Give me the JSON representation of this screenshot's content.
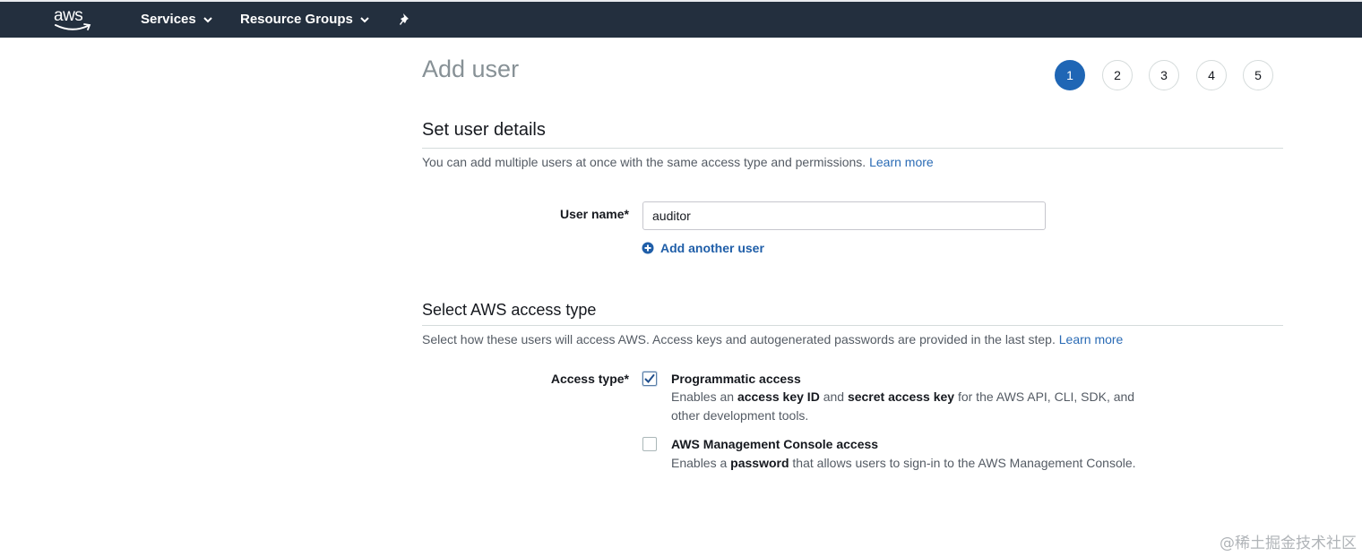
{
  "topbar": {
    "logo": "aws",
    "services_label": "Services",
    "resource_groups_label": "Resource Groups",
    "colors": {
      "background": "#232f3e",
      "text": "#ffffff"
    }
  },
  "page": {
    "title": "Add user",
    "steps": [
      "1",
      "2",
      "3",
      "4",
      "5"
    ],
    "active_step": "1",
    "accent_color": "#1f66b5"
  },
  "user_details": {
    "title": "Set user details",
    "description": "You can add multiple users at once with the same access type and permissions.",
    "learn_more": "Learn more",
    "username_label": "User name*",
    "username_value": "auditor",
    "add_another_user": "Add another user"
  },
  "access_type": {
    "title": "Select AWS access type",
    "description": "Select how these users will access AWS. Access keys and autogenerated passwords are provided in the last step.",
    "learn_more": "Learn more",
    "label": "Access type*",
    "programmatic": {
      "title": "Programmatic access",
      "checked": true,
      "desc_1": "Enables an ",
      "desc_b1": "access key ID",
      "desc_2": " and ",
      "desc_b2": "secret access key",
      "desc_3": " for the AWS API, CLI, SDK, and other development tools."
    },
    "console": {
      "title": "AWS Management Console access",
      "checked": false,
      "desc_1": "Enables a ",
      "desc_b1": "password",
      "desc_2": " that allows users to sign-in to the AWS Management Console."
    }
  },
  "watermark": "@稀土掘金技术社区"
}
